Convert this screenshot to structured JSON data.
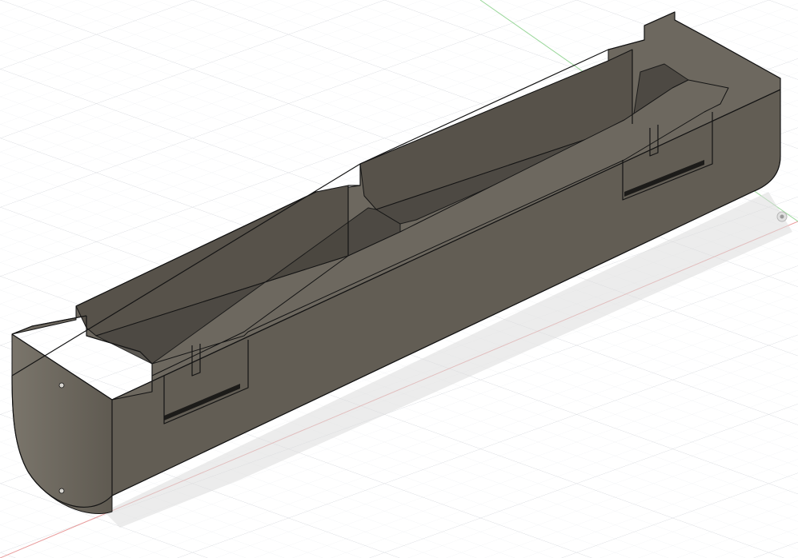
{
  "viewport": {
    "background": "#ffffff",
    "grid_minor_color": "#eceef1",
    "grid_major_color": "#d3d6db",
    "x_axis_color": "#e89a9a",
    "y_axis_color": "#9ad79a"
  },
  "model": {
    "body_side_color": "#625d54",
    "body_top_color": "#6d685f",
    "end_cap_color": "#6e695f",
    "inner_wall_color": "#57524a",
    "compartment_floor_color": "#4a4640",
    "edge_color": "#141414",
    "slot_color": "#1c1b19",
    "shadow_color": "#dcdcdc"
  },
  "view_cube": {
    "icon": "origin-marker-icon"
  }
}
